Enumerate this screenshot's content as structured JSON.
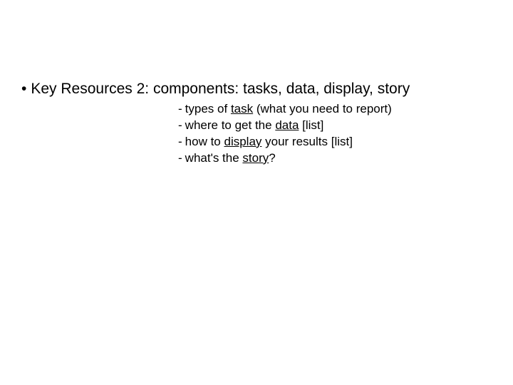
{
  "main": {
    "bullet_text": "Key Resources 2: components: tasks, data, display, story"
  },
  "sub": {
    "items": [
      {
        "pre": "types of ",
        "u": "task",
        "post": " (what you need to report)"
      },
      {
        "pre": "where to get the ",
        "u": "data",
        "post": " [list]"
      },
      {
        "pre": "how to ",
        "u": "display",
        "post": " your results [list]"
      },
      {
        "pre": "what's the ",
        "u": "story",
        "post": "?"
      }
    ]
  }
}
